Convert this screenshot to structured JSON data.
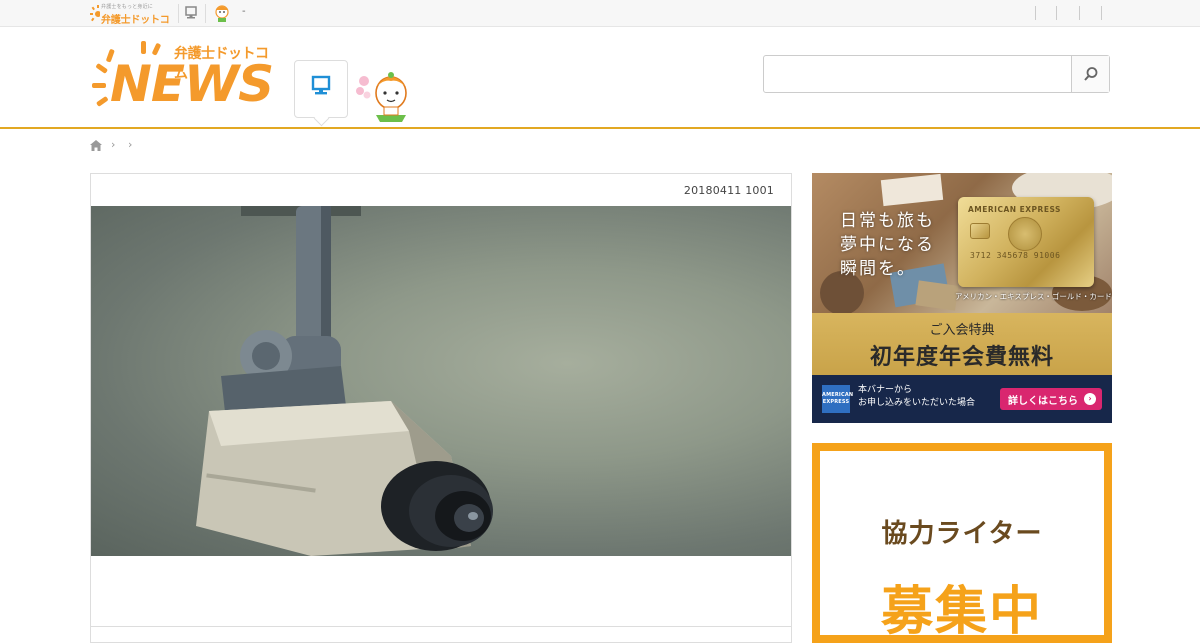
{
  "topbar": {
    "mini_logo_tagline": "弁護士をもっと身近に",
    "mini_logo_name": "弁護士ドットコム",
    "dash": "-"
  },
  "header": {
    "logo_small": "弁護士ドットコム",
    "logo_big": "NEWS",
    "search": {
      "value": "",
      "placeholder": ""
    }
  },
  "article": {
    "date": "20180411 1001"
  },
  "sidebar": {
    "amex_ad": {
      "headline": [
        "日常も旅も",
        "夢中になる",
        "瞬間を。"
      ],
      "card_brand": "AMERICAN EXPRESS",
      "card_number": "3712  345678  91006",
      "card_caption": "アメリカン・エキスプレス・ゴールド・カード",
      "offer_sub": "ご入会特典",
      "offer_main": "初年度年会費無料",
      "logo_text": "AMERICAN EXPRESS",
      "note": [
        "本バナーから",
        "お申し込みをいただいた場合"
      ],
      "cta": "詳しくはこちら"
    },
    "writer_ad": {
      "line1": "協力ライター",
      "line2": "募集中"
    }
  },
  "colors": {
    "brand_orange": "#f49a2c",
    "header_rule": "#e2a823",
    "writer_border": "#f5a21a",
    "amex_navy": "#17274a",
    "amex_gold": "#d8b55e",
    "cta_pink": "#d9266f"
  }
}
